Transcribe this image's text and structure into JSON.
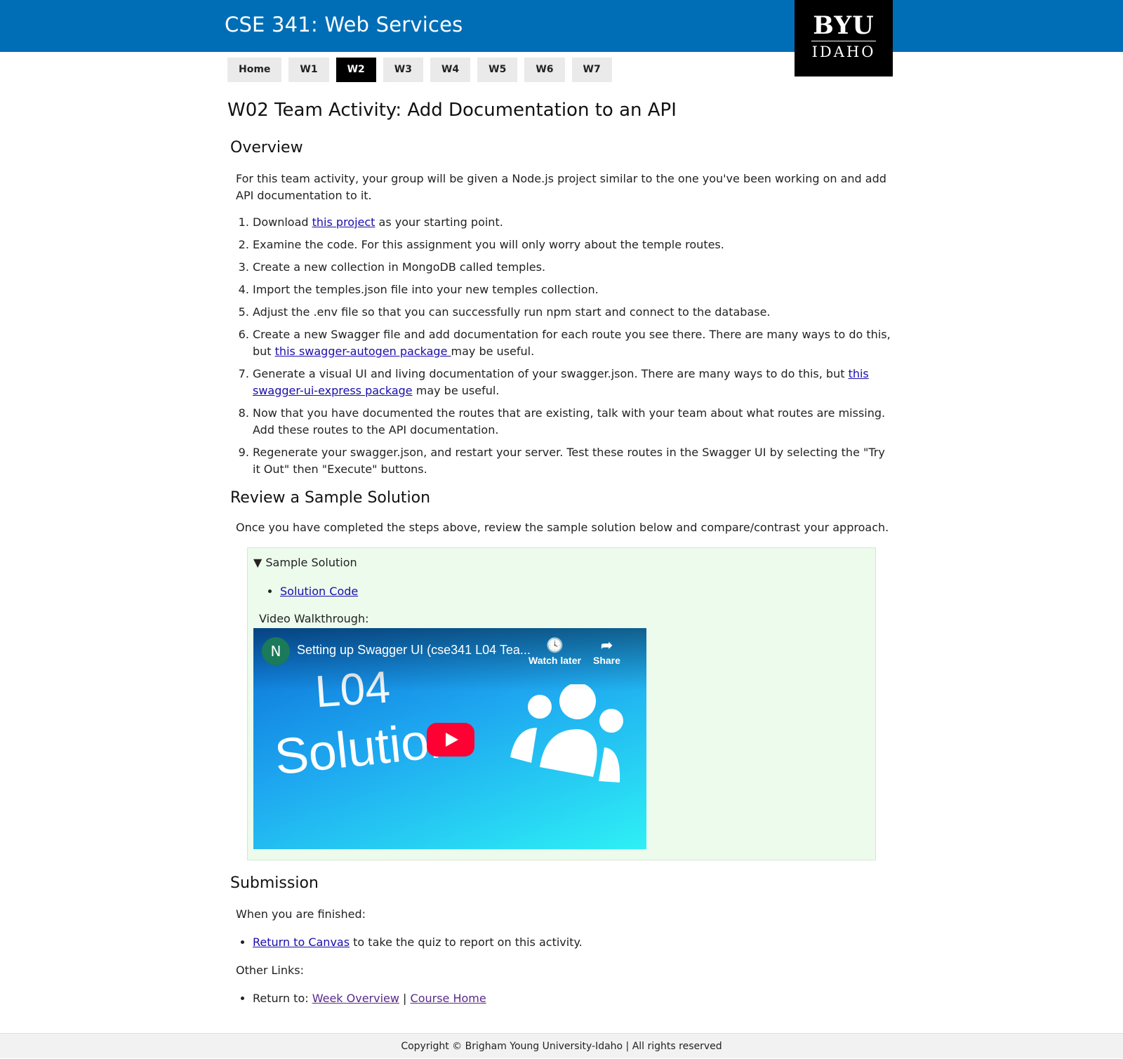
{
  "header": {
    "site_title": "CSE 341: Web Services",
    "logo_top": "BYU",
    "logo_bottom": "IDAHO"
  },
  "nav": {
    "items": [
      "Home",
      "W1",
      "W2",
      "W3",
      "W4",
      "W5",
      "W6",
      "W7"
    ],
    "active": "W2"
  },
  "page": {
    "title": "W02 Team Activity: Add Documentation to an API",
    "overview_heading": "Overview",
    "overview_text": "For this team activity, your group will be given a Node.js project similar to the one you've been working on and add API documentation to it.",
    "steps": {
      "s1_pre": "Download ",
      "s1_link": "this project",
      "s1_post": " as your starting point.",
      "s2": "Examine the code. For this assignment you will only worry about the temple routes.",
      "s3": "Create a new collection in MongoDB called temples.",
      "s4": "Import the temples.json file into your new temples collection.",
      "s5": "Adjust the .env file so that you can successfully run npm start and connect to the database.",
      "s6_pre": "Create a new Swagger file and add documentation for each route you see there. There are many ways to do this, but ",
      "s6_link": "this swagger-autogen package ",
      "s6_post": "may be useful.",
      "s7_pre": "Generate a visual UI and living documentation of your swagger.json. There are many ways to do this, but ",
      "s7_link": "this swagger-ui-express package",
      "s7_post": " may be useful.",
      "s8": "Now that you have documented the routes that are existing, talk with your team about what routes are missing. Add these routes to the API documentation.",
      "s9": "Regenerate your swagger.json, and restart your server. Test these routes in the Swagger UI by selecting the \"Try it Out\" then \"Execute\" buttons."
    },
    "review_heading": "Review a Sample Solution",
    "review_text": "Once you have completed the steps above, review the sample solution below and compare/contrast your approach.",
    "sample": {
      "summary": "▼ Sample Solution",
      "solution_link": "Solution Code",
      "video_label": "Video Walkthrough:"
    },
    "video": {
      "channel_initial": "N",
      "title": "Setting up Swagger UI (cse341 L04 Tea...",
      "watch_later": "Watch later",
      "share": "Share",
      "thumb_line1": "L04",
      "thumb_line2": "Solution"
    },
    "submission_heading": "Submission",
    "finished_text": "When you are finished:",
    "canvas_link": "Return to Canvas",
    "canvas_post": " to take the quiz to report on this activity.",
    "other_links": "Other Links:",
    "return_to": "Return to: ",
    "week_overview": "Week Overview",
    "separator": " | ",
    "course_home": "Course Home"
  },
  "footer": {
    "copyright": "Copyright © Brigham Young University-Idaho | All rights reserved"
  },
  "colors": {
    "header_blue": "#006eb6",
    "details_bg": "#ecfbec",
    "link": "#1a0dab",
    "play_red": "#ff0033"
  }
}
